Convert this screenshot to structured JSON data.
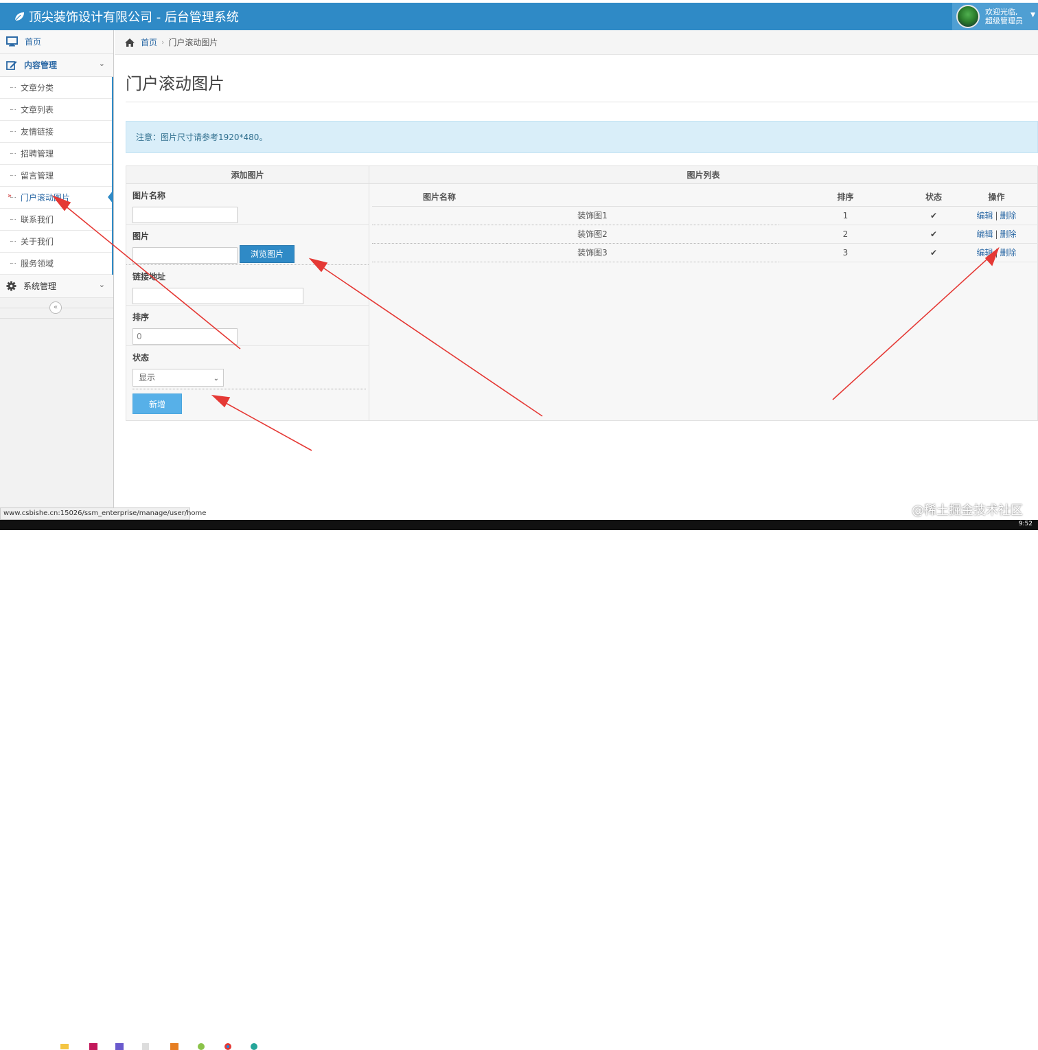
{
  "header": {
    "brand": "顶尖装饰设计有限公司 - 后台管理系统",
    "welcome_line1": "欢迎光临,",
    "welcome_line2": "超级管理员"
  },
  "sidebar": {
    "home": "首页",
    "content_group": "内容管理",
    "items": [
      "文章分类",
      "文章列表",
      "友情链接",
      "招聘管理",
      "留言管理",
      "门户滚动图片",
      "联系我们",
      "关于我们",
      "服务领域"
    ],
    "system_group": "系统管理",
    "collapse": "«"
  },
  "breadcrumb": {
    "home": "首页",
    "current": "门户滚动图片"
  },
  "page": {
    "title": "门户滚动图片",
    "notice": "注意：图片尺寸请参考1920*480。"
  },
  "form": {
    "heading": "添加图片",
    "name_label": "图片名称",
    "image_label": "图片",
    "browse_label": "浏览图片",
    "link_label": "链接地址",
    "sort_label": "排序",
    "sort_value": "0",
    "status_label": "状态",
    "status_value": "显示",
    "submit_label": "新增"
  },
  "list": {
    "heading": "图片列表",
    "columns": [
      "图片名称",
      "排序",
      "状态",
      "操作"
    ],
    "rows": [
      {
        "name": "装饰图1",
        "sort": "1",
        "edit": "编辑",
        "delete": "删除"
      },
      {
        "name": "装饰图2",
        "sort": "2",
        "edit": "编辑",
        "delete": "删除"
      },
      {
        "name": "装饰图3",
        "sort": "3",
        "edit": "编辑",
        "delete": "删除"
      }
    ],
    "separator": "|"
  },
  "status_url": "www.csbishe.cn:15026/ssm_enterprise/manage/user/home",
  "watermark": "@稀土掘金技术社区",
  "clock": "9:52",
  "colors": {
    "header_bg": "#2f8ac6",
    "link": "#2d6aa6",
    "alert_bg": "#d9eef9",
    "annotation_arrow": "#e53935"
  }
}
